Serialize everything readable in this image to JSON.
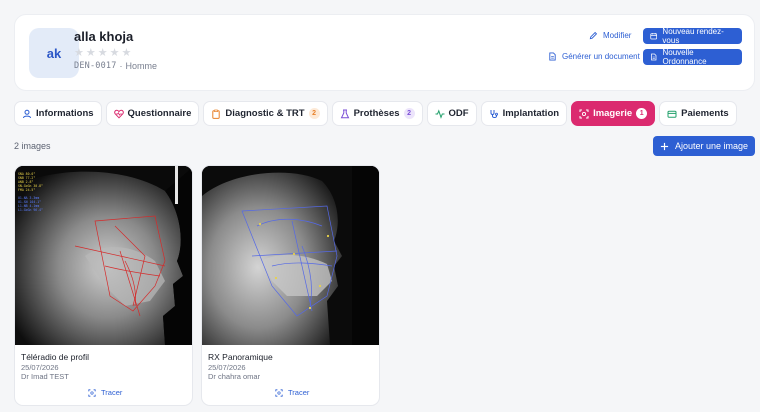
{
  "patient": {
    "initials": "ak",
    "name": "alla khoja",
    "code": "DEN-0017",
    "separator": "·",
    "gender": "Homme",
    "rating": 0,
    "stars": 5
  },
  "actions": {
    "modify": "Modifier",
    "new_appointment": "Nouveau rendez-vous",
    "generate_doc": "Générer un document",
    "new_prescription": "Nouvelle Ordonnance"
  },
  "tabs": [
    {
      "label": "Informations",
      "icon": "user-icon",
      "badge": null,
      "active": false
    },
    {
      "label": "Questionnaire",
      "icon": "heart-pulse-icon",
      "badge": null,
      "active": false
    },
    {
      "label": "Diagnostic & TRT",
      "icon": "clipboard-icon",
      "badge": "2",
      "active": false
    },
    {
      "label": "Prothèses",
      "icon": "flask-icon",
      "badge": "2",
      "active": false
    },
    {
      "label": "ODF",
      "icon": "activity-icon",
      "badge": null,
      "active": false
    },
    {
      "label": "Implantation",
      "icon": "stethoscope-icon",
      "badge": null,
      "active": false
    },
    {
      "label": "Imagerie",
      "icon": "scan-icon",
      "badge": "1",
      "active": true
    },
    {
      "label": "Paiements",
      "icon": "wallet-icon",
      "badge": null,
      "active": false
    }
  ],
  "gallery": {
    "count_label": "2 images",
    "add_label": "Ajouter une image",
    "images": [
      {
        "title": "Téléradio de profil",
        "date": "25/07/2026",
        "doctor": "Dr Imad TEST",
        "action": "Tracer"
      },
      {
        "title": "RX Panoramique",
        "date": "25/07/2026",
        "doctor": "Dr chahra omar",
        "action": "Tracer"
      }
    ]
  },
  "colors": {
    "primary": "#2d5fd3",
    "active_tab": "#db2a6f",
    "badge_orange": "#e8812a",
    "badge_purple": "#7b4fd6"
  }
}
